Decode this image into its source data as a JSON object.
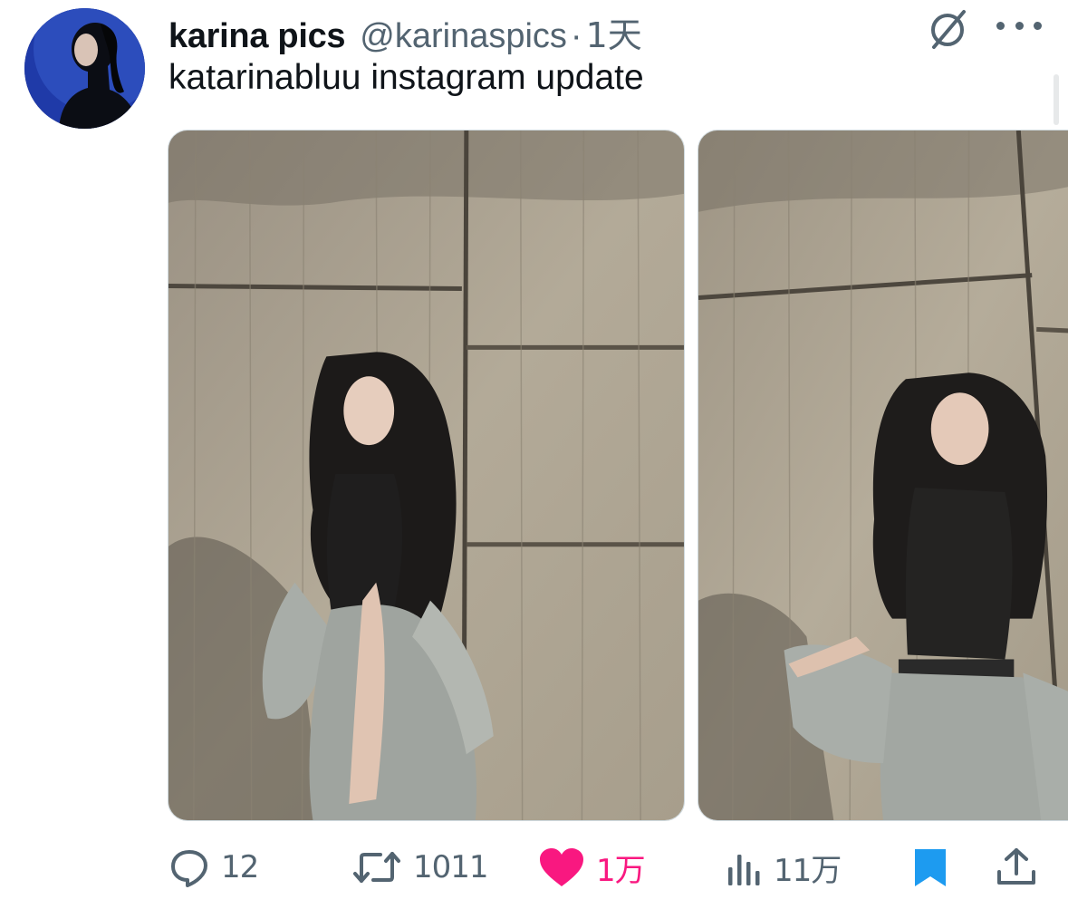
{
  "tweet": {
    "display_name": "karina pics",
    "handle": "@karinaspics",
    "separator": "·",
    "time": "1天",
    "text": "katarinabluu instagram update"
  },
  "actions": {
    "replies": "12",
    "retweets": "1011",
    "likes": "1万",
    "views": "11万",
    "liked": true,
    "bookmarked": true
  },
  "media": [
    {
      "alt": "photo 1"
    },
    {
      "alt": "photo 2"
    }
  ],
  "colors": {
    "text_primary": "#0f1419",
    "text_secondary": "#536471",
    "like": "#f91880",
    "bookmark": "#1d9bf0"
  },
  "icons": {
    "reply": "reply-icon",
    "retweet": "retweet-icon",
    "like": "heart-icon",
    "views": "views-icon",
    "bookmark": "bookmark-icon",
    "share": "share-icon",
    "grok": "grok-icon",
    "more": "more-icon"
  }
}
